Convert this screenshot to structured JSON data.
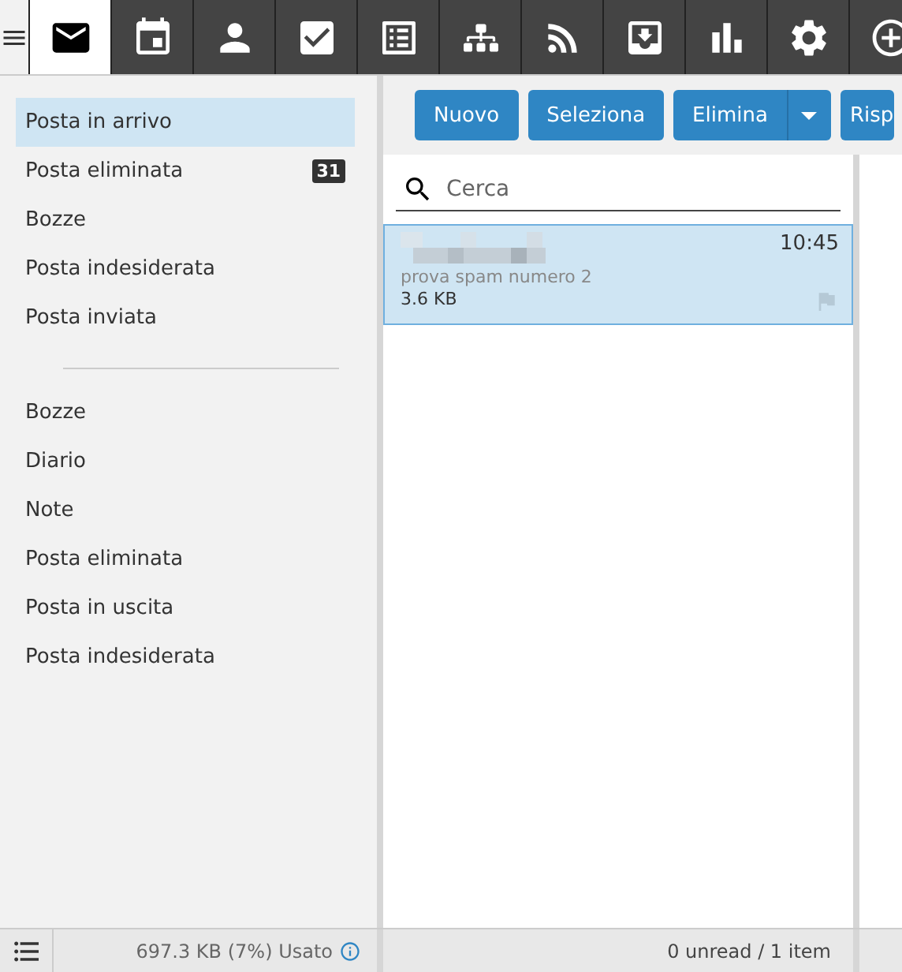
{
  "tabs": [
    {
      "selected": true
    },
    {
      "selected": false
    },
    {
      "selected": false
    },
    {
      "selected": false
    },
    {
      "selected": false
    },
    {
      "selected": false
    },
    {
      "selected": false
    },
    {
      "selected": false
    },
    {
      "selected": false
    },
    {
      "selected": false
    },
    {
      "selected": false
    }
  ],
  "folder_groups": [
    [
      {
        "label": "Posta in arrivo",
        "selected": true
      },
      {
        "label": "Posta eliminata",
        "selected": false,
        "badge": "31"
      },
      {
        "label": "Bozze",
        "selected": false
      },
      {
        "label": "Posta indesiderata",
        "selected": false
      },
      {
        "label": "Posta inviata",
        "selected": false
      }
    ],
    [
      {
        "label": "Bozze",
        "selected": false
      },
      {
        "label": "Diario",
        "selected": false
      },
      {
        "label": "Note",
        "selected": false
      },
      {
        "label": "Posta eliminata",
        "selected": false
      },
      {
        "label": "Posta in uscita",
        "selected": false
      },
      {
        "label": "Posta indesiderata",
        "selected": false
      }
    ]
  ],
  "toolbar": {
    "buttons": [
      "Nuovo",
      "Seleziona",
      "Elimina",
      "Risp"
    ]
  },
  "search": {
    "placeholder": "Cerca"
  },
  "messages": [
    {
      "time": "10:45",
      "subject": "prova spam numero 2",
      "size": "3.6 KB",
      "selected": true
    }
  ],
  "quota": "697.3 KB (7%) Usato",
  "list_status": "0 unread / 1 item"
}
